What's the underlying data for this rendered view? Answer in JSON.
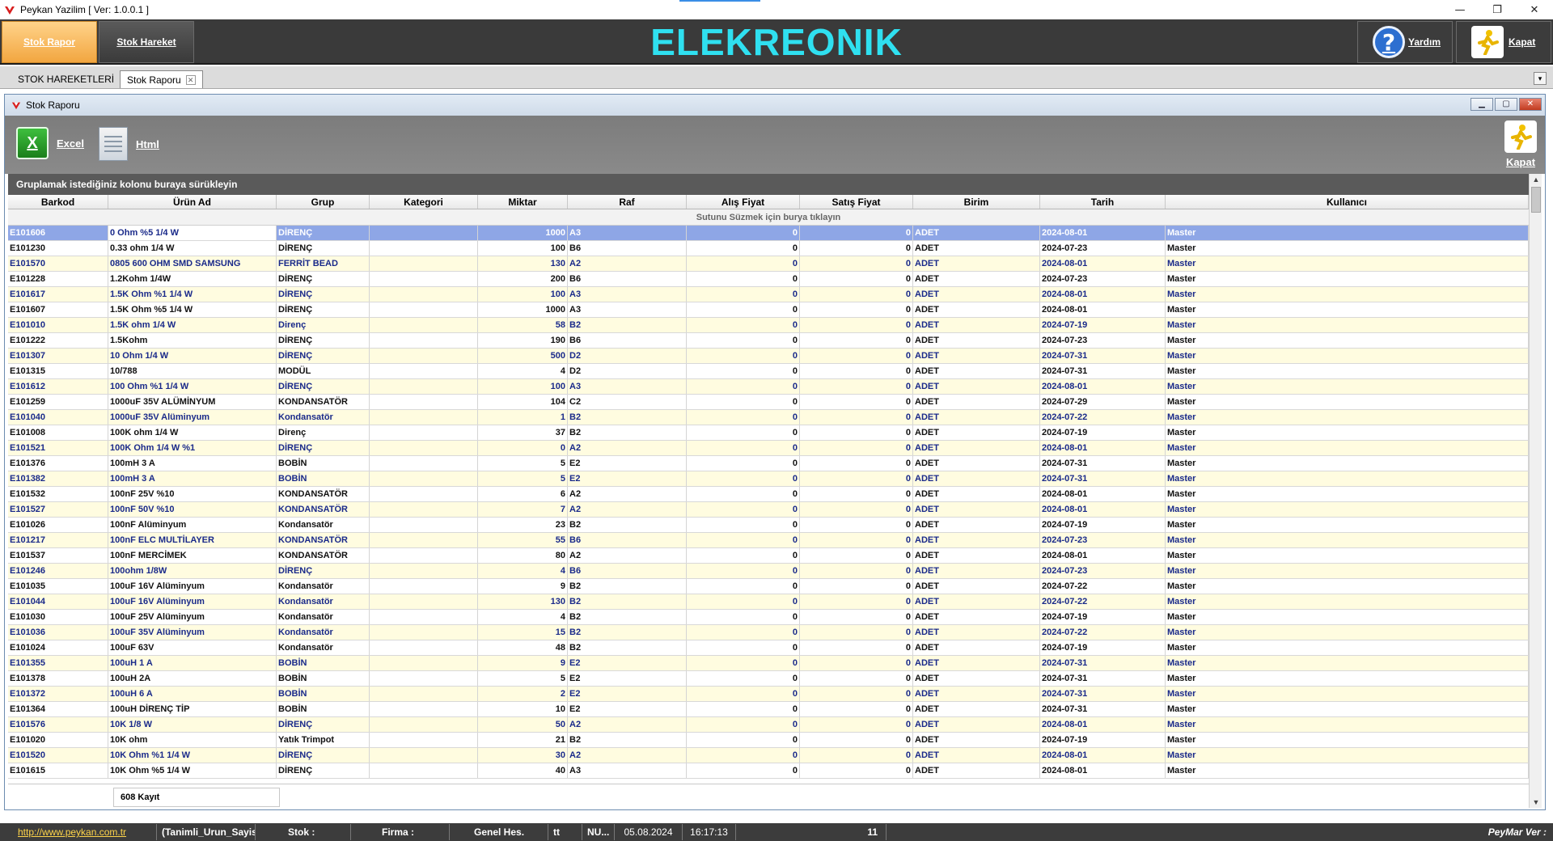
{
  "titlebar": {
    "title": "Peykan Yazilim   [ Ver: 1.0.0.1 ]",
    "minimize": "—",
    "maximize": "❐",
    "close": "✕"
  },
  "header": {
    "nav": [
      {
        "label": "Stok Rapor"
      },
      {
        "label": "Stok Hareket"
      }
    ],
    "app_title": "ELEKREONIK",
    "help_label": "Yardım",
    "close_label": "Kapat",
    "help_glyph": "?"
  },
  "tabs": [
    {
      "label": "STOK HAREKETLERİ"
    },
    {
      "label": "Stok Raporu"
    }
  ],
  "child": {
    "title": "Stok Raporu",
    "toolbar": {
      "excel_label": "Excel",
      "html_label": "Html",
      "close_label": "Kapat",
      "excel_glyph": "X"
    },
    "group_hint": "Gruplamak istediğiniz kolonu buraya sürükleyin",
    "filter_hint": "Sutunu Süzmek için burya tıklayın",
    "columns": [
      "Barkod",
      "Ürün Ad",
      "Grup",
      "Kategori",
      "Miktar",
      "Raf",
      "Alış Fiyat",
      "Satış Fiyat",
      "Birim",
      "Tarih",
      "Kullanıcı"
    ],
    "rows": [
      [
        "E101606",
        "0 Ohm %5 1/4 W",
        "DİRENÇ",
        "",
        "1000",
        "A3",
        "0",
        "0",
        "ADET",
        "2024-08-01",
        "Master"
      ],
      [
        "E101230",
        "0.33 ohm 1/4 W",
        "DİRENÇ",
        "",
        "100",
        "B6",
        "0",
        "0",
        "ADET",
        "2024-07-23",
        "Master"
      ],
      [
        "E101570",
        "0805 600 OHM SMD SAMSUNG",
        "FERRİT BEAD",
        "",
        "130",
        "A2",
        "0",
        "0",
        "ADET",
        "2024-08-01",
        "Master"
      ],
      [
        "E101228",
        "1.2Kohm 1/4W",
        "DİRENÇ",
        "",
        "200",
        "B6",
        "0",
        "0",
        "ADET",
        "2024-07-23",
        "Master"
      ],
      [
        "E101617",
        "1.5K Ohm %1 1/4 W",
        "DİRENÇ",
        "",
        "100",
        "A3",
        "0",
        "0",
        "ADET",
        "2024-08-01",
        "Master"
      ],
      [
        "E101607",
        "1.5K Ohm %5 1/4 W",
        "DİRENÇ",
        "",
        "1000",
        "A3",
        "0",
        "0",
        "ADET",
        "2024-08-01",
        "Master"
      ],
      [
        "E101010",
        "1.5K ohm 1/4 W",
        "Direnç",
        "",
        "58",
        "B2",
        "0",
        "0",
        "ADET",
        "2024-07-19",
        "Master"
      ],
      [
        "E101222",
        "1.5Kohm",
        "DİRENÇ",
        "",
        "190",
        "B6",
        "0",
        "0",
        "ADET",
        "2024-07-23",
        "Master"
      ],
      [
        "E101307",
        "10 Ohm 1/4 W",
        "DİRENÇ",
        "",
        "500",
        "D2",
        "0",
        "0",
        "ADET",
        "2024-07-31",
        "Master"
      ],
      [
        "E101315",
        "10/788",
        "MODÜL",
        "",
        "4",
        "D2",
        "0",
        "0",
        "ADET",
        "2024-07-31",
        "Master"
      ],
      [
        "E101612",
        "100 Ohm %1 1/4 W",
        "DİRENÇ",
        "",
        "100",
        "A3",
        "0",
        "0",
        "ADET",
        "2024-08-01",
        "Master"
      ],
      [
        "E101259",
        "1000uF 35V ALÜMİNYUM",
        "KONDANSATÖR",
        "",
        "104",
        "C2",
        "0",
        "0",
        "ADET",
        "2024-07-29",
        "Master"
      ],
      [
        "E101040",
        "1000uF 35V Alüminyum",
        "Kondansatör",
        "",
        "1",
        "B2",
        "0",
        "0",
        "ADET",
        "2024-07-22",
        "Master"
      ],
      [
        "E101008",
        "100K ohm 1/4 W",
        "Direnç",
        "",
        "37",
        "B2",
        "0",
        "0",
        "ADET",
        "2024-07-19",
        "Master"
      ],
      [
        "E101521",
        "100K Ohm 1/4 W %1",
        "DİRENÇ",
        "",
        "0",
        "A2",
        "0",
        "0",
        "ADET",
        "2024-08-01",
        "Master"
      ],
      [
        "E101376",
        "100mH 3 A",
        "BOBİN",
        "",
        "5",
        "E2",
        "0",
        "0",
        "ADET",
        "2024-07-31",
        "Master"
      ],
      [
        "E101382",
        "100mH 3 A",
        "BOBİN",
        "",
        "5",
        "E2",
        "0",
        "0",
        "ADET",
        "2024-07-31",
        "Master"
      ],
      [
        "E101532",
        "100nF 25V %10",
        "KONDANSATÖR",
        "",
        "6",
        "A2",
        "0",
        "0",
        "ADET",
        "2024-08-01",
        "Master"
      ],
      [
        "E101527",
        "100nF 50V %10",
        "KONDANSATÖR",
        "",
        "7",
        "A2",
        "0",
        "0",
        "ADET",
        "2024-08-01",
        "Master"
      ],
      [
        "E101026",
        "100nF Alüminyum",
        "Kondansatör",
        "",
        "23",
        "B2",
        "0",
        "0",
        "ADET",
        "2024-07-19",
        "Master"
      ],
      [
        "E101217",
        "100nF ELC MULTİLAYER",
        "KONDANSATÖR",
        "",
        "55",
        "B6",
        "0",
        "0",
        "ADET",
        "2024-07-23",
        "Master"
      ],
      [
        "E101537",
        "100nF MERCİMEK",
        "KONDANSATÖR",
        "",
        "80",
        "A2",
        "0",
        "0",
        "ADET",
        "2024-08-01",
        "Master"
      ],
      [
        "E101246",
        "100ohm 1/8W",
        "DİRENÇ",
        "",
        "4",
        "B6",
        "0",
        "0",
        "ADET",
        "2024-07-23",
        "Master"
      ],
      [
        "E101035",
        "100uF 16V Alüminyum",
        "Kondansatör",
        "",
        "9",
        "B2",
        "0",
        "0",
        "ADET",
        "2024-07-22",
        "Master"
      ],
      [
        "E101044",
        "100uF 16V Alüminyum",
        "Kondansatör",
        "",
        "130",
        "B2",
        "0",
        "0",
        "ADET",
        "2024-07-22",
        "Master"
      ],
      [
        "E101030",
        "100uF 25V Alüminyum",
        "Kondansatör",
        "",
        "4",
        "B2",
        "0",
        "0",
        "ADET",
        "2024-07-19",
        "Master"
      ],
      [
        "E101036",
        "100uF 35V Alüminyum",
        "Kondansatör",
        "",
        "15",
        "B2",
        "0",
        "0",
        "ADET",
        "2024-07-22",
        "Master"
      ],
      [
        "E101024",
        "100uF 63V",
        "Kondansatör",
        "",
        "48",
        "B2",
        "0",
        "0",
        "ADET",
        "2024-07-19",
        "Master"
      ],
      [
        "E101355",
        "100uH 1 A",
        "BOBİN",
        "",
        "9",
        "E2",
        "0",
        "0",
        "ADET",
        "2024-07-31",
        "Master"
      ],
      [
        "E101378",
        "100uH 2A",
        "BOBİN",
        "",
        "5",
        "E2",
        "0",
        "0",
        "ADET",
        "2024-07-31",
        "Master"
      ],
      [
        "E101372",
        "100uH 6 A",
        "BOBİN",
        "",
        "2",
        "E2",
        "0",
        "0",
        "ADET",
        "2024-07-31",
        "Master"
      ],
      [
        "E101364",
        "100uH DİRENÇ TİP",
        "BOBİN",
        "",
        "10",
        "E2",
        "0",
        "0",
        "ADET",
        "2024-07-31",
        "Master"
      ],
      [
        "E101576",
        "10K 1/8 W",
        "DİRENÇ",
        "",
        "50",
        "A2",
        "0",
        "0",
        "ADET",
        "2024-08-01",
        "Master"
      ],
      [
        "E101020",
        "10K ohm",
        "Yatık Trimpot",
        "",
        "21",
        "B2",
        "0",
        "0",
        "ADET",
        "2024-07-19",
        "Master"
      ],
      [
        "E101520",
        "10K Ohm %1 1/4 W",
        "DİRENÇ",
        "",
        "30",
        "A2",
        "0",
        "0",
        "ADET",
        "2024-08-01",
        "Master"
      ],
      [
        "E101615",
        "10K Ohm %5 1/4 W",
        "DİRENÇ",
        "",
        "40",
        "A3",
        "0",
        "0",
        "ADET",
        "2024-08-01",
        "Master"
      ]
    ],
    "record_count": "608 Kayıt"
  },
  "statusbar": {
    "url": "http://www.peykan.com.tr",
    "items": [
      "(Tanimli_Urun_Sayisi)",
      "Stok :",
      "Firma :",
      "Genel Hes.",
      "tt",
      "NU...",
      "05.08.2024",
      "16:17:13",
      "11",
      "PeyMar Ver :"
    ]
  },
  "colors": {
    "header_bg": "#3a3a3a",
    "title_cyan": "#2fe0f0",
    "active_nav": "#f2a640",
    "row_even": "#fffce0",
    "row_selected": "#8ea6e6"
  }
}
